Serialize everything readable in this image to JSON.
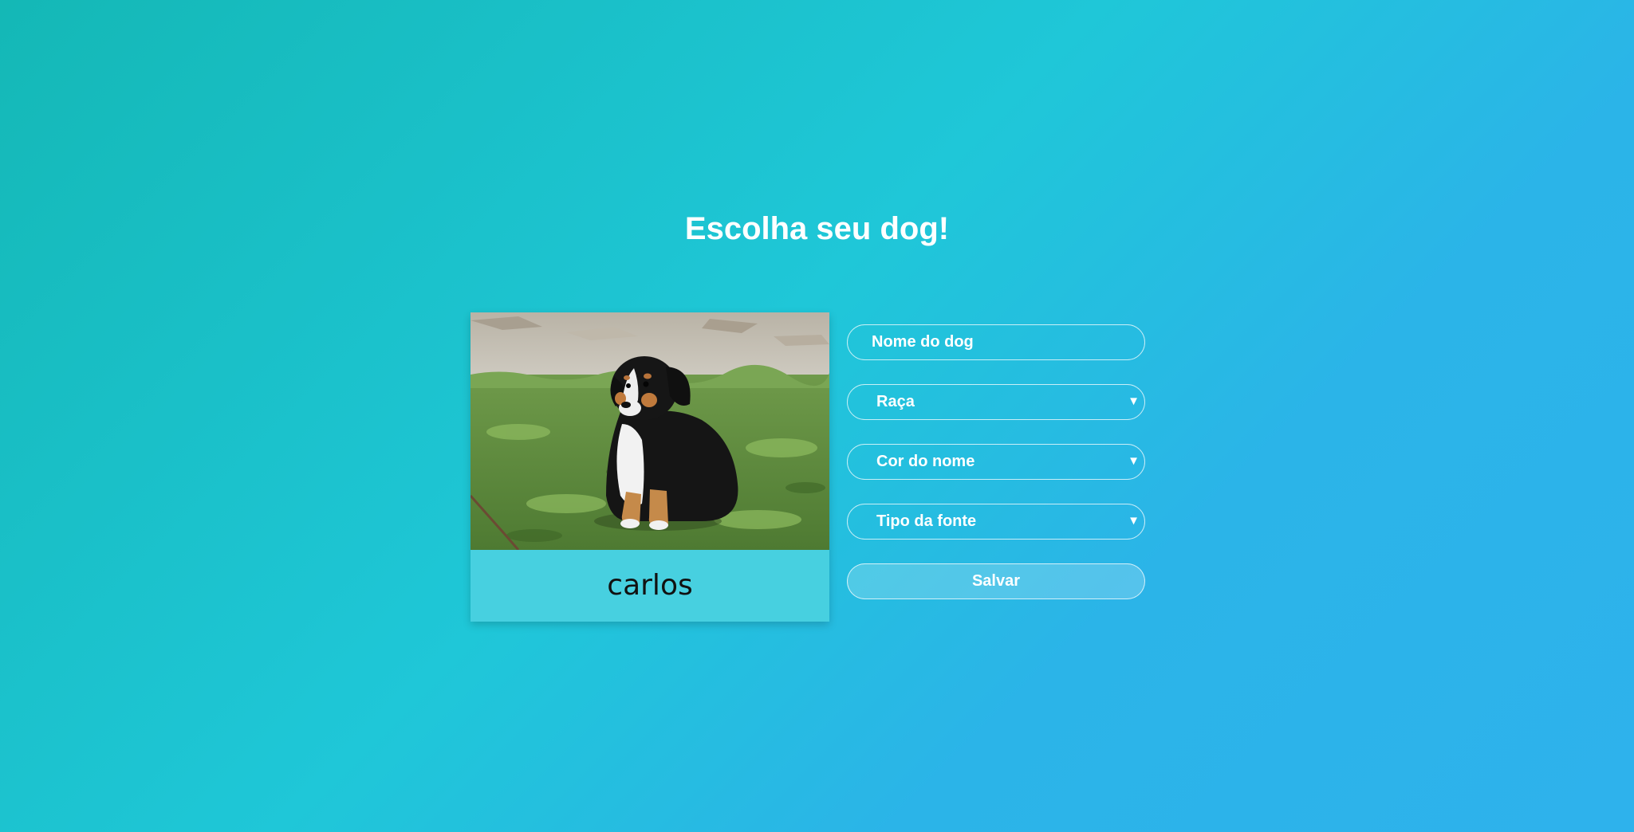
{
  "page": {
    "title": "Escolha seu dog!"
  },
  "card": {
    "dog_name": "carlos",
    "image_subject": "bernese-mountain-dog-puppy-photo"
  },
  "form": {
    "name_placeholder": "Nome do dog",
    "breed_label": "Raça",
    "name_color_label": "Cor do nome",
    "font_type_label": "Tipo da fonte",
    "save_label": "Salvar",
    "caret_icon": "chevron-down-icon"
  },
  "colors": {
    "background_start": "#14b8b6",
    "background_end": "#2eb2ec",
    "card_footer": "#47d0e0",
    "text": "#ffffff",
    "dog_name_text": "#111111"
  }
}
